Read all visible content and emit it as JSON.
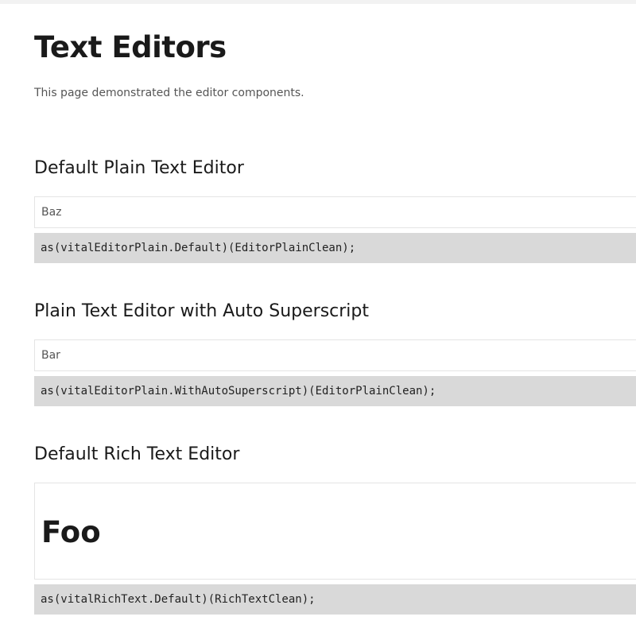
{
  "page": {
    "title": "Text Editors",
    "subtitle": "This page demonstrated the editor components."
  },
  "sections": [
    {
      "heading": "Default Plain Text Editor",
      "editor_value": "Baz",
      "code": "as(vitalEditorPlain.Default)(EditorPlainClean);"
    },
    {
      "heading": "Plain Text Editor with Auto Superscript",
      "editor_value": "Bar",
      "code": "as(vitalEditorPlain.WithAutoSuperscript)(EditorPlainClean);"
    },
    {
      "heading": "Default Rich Text Editor",
      "editor_value": "Foo",
      "code": "as(vitalRichText.Default)(RichTextClean);"
    }
  ]
}
